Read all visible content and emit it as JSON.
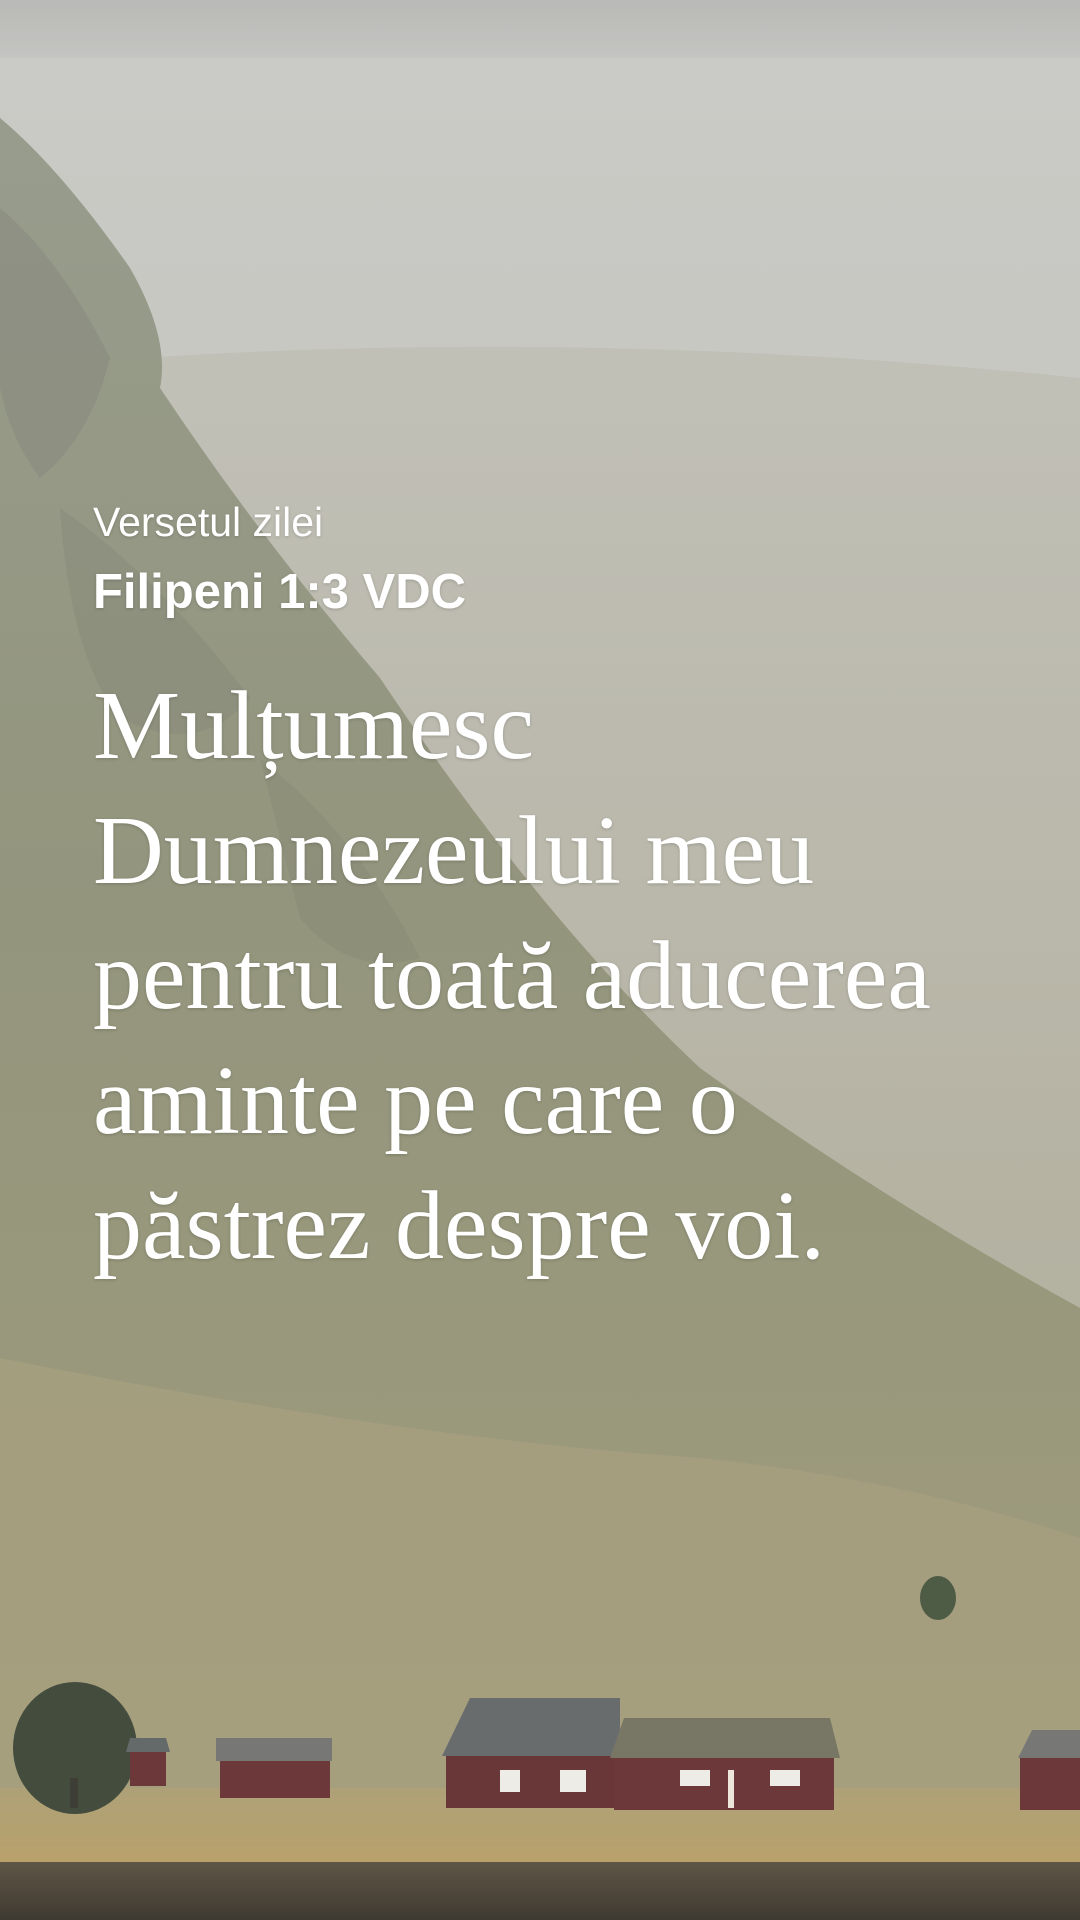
{
  "verse_of_day": {
    "label": "Versetul zilei",
    "reference": "Filipeni 1:3 VDC",
    "text": "Mulțumesc Dumnezeului meu pentru toată aducerea aminte pe care o păstrez despre voi."
  },
  "background": {
    "subject": "misty mountain slope with red cabins",
    "colors": {
      "sky": "#c9c9c5",
      "slope": "#8a8c70",
      "cabins": "#5e2326",
      "field": "#b59a5e"
    }
  }
}
